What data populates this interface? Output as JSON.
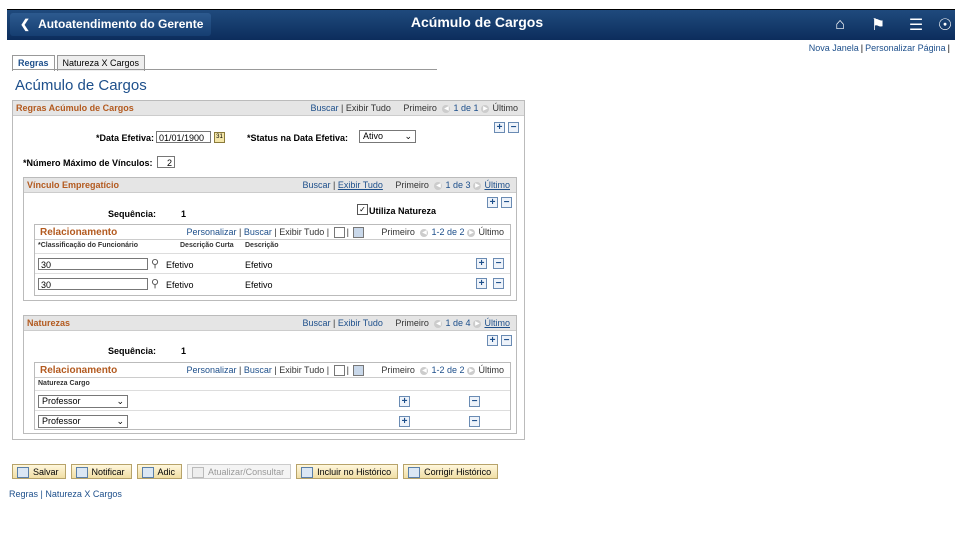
{
  "header": {
    "back_label": "Autoatendimento do Gerente",
    "title": "Acúmulo de Cargos",
    "icons": [
      "home-icon",
      "flag-icon",
      "menu-icon",
      "compass-icon"
    ]
  },
  "top_links": {
    "new_window": "Nova Janela",
    "personalize_page": "Personalizar Página"
  },
  "tabs": [
    "Regras",
    "Natureza X Cargos"
  ],
  "page_title": "Acúmulo de Cargos",
  "regras": {
    "title": "Regras Acúmulo de Cargos",
    "buscar": "Buscar",
    "exibir_tudo": "Exibir Tudo",
    "primeiro": "Primeiro",
    "range": "1 de 1",
    "ultimo": "Último",
    "data_efetiva_label": "*Data Efetiva:",
    "data_efetiva_value": "01/01/1900",
    "status_label": "*Status na Data Efetiva:",
    "status_value": "Ativo",
    "num_max_label": "*Número Máximo de Vínculos:",
    "num_max_value": "2"
  },
  "vinculo": {
    "title": "Vínculo Empregatício",
    "buscar": "Buscar",
    "exibir_tudo": "Exibir Tudo",
    "primeiro": "Primeiro",
    "range": "1 de 3",
    "ultimo": "Último",
    "seq_label": "Sequência:",
    "seq_value": "1",
    "utiliza_natureza": "Utiliza Natureza",
    "rel": {
      "title": "Relacionamento",
      "personalizar": "Personalizar",
      "buscar": "Buscar",
      "exibir_tudo": "Exibir Tudo",
      "primeiro": "Primeiro",
      "range": "1-2 de 2",
      "ultimo": "Último",
      "columns": [
        "*Classificação do Funcionário",
        "Descrição Curta",
        "Descrição"
      ],
      "rows": [
        {
          "classificacao": "30",
          "curta": "Efetivo",
          "descricao": "Efetivo"
        },
        {
          "classificacao": "30",
          "curta": "Efetivo",
          "descricao": "Efetivo"
        }
      ]
    }
  },
  "naturezas": {
    "title": "Naturezas",
    "buscar": "Buscar",
    "exibir_tudo": "Exibir Tudo",
    "primeiro": "Primeiro",
    "range": "1 de 4",
    "ultimo": "Último",
    "seq_label": "Sequência:",
    "seq_value": "1",
    "rel": {
      "title": "Relacionamento",
      "personalizar": "Personalizar",
      "buscar": "Buscar",
      "exibir_tudo": "Exibir Tudo",
      "primeiro": "Primeiro",
      "range": "1-2 de 2",
      "ultimo": "Último",
      "column": "Natureza Cargo",
      "rows": [
        {
          "natureza": "Professor"
        },
        {
          "natureza": "Professor"
        }
      ]
    }
  },
  "toolbar": {
    "salvar": "Salvar",
    "notificar": "Notificar",
    "adic": "Adic",
    "atualizar": "Atualizar/Consultar",
    "incluir": "Incluir no Histórico",
    "corrigir": "Corrigir Histórico"
  },
  "footer_links": {
    "regras": "Regras",
    "natureza": "Natureza X Cargos"
  }
}
